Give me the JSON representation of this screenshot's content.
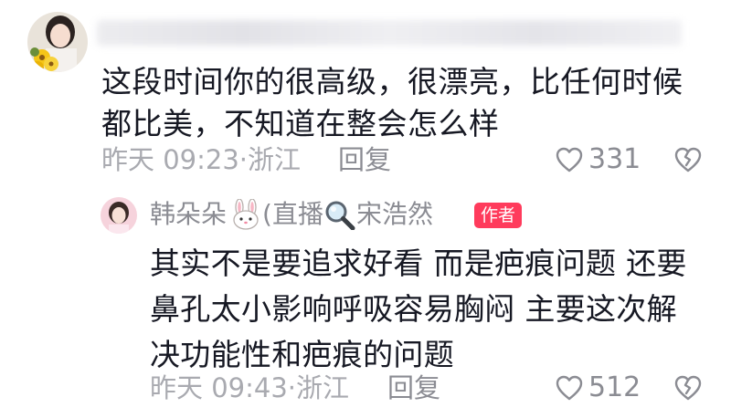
{
  "comment": {
    "text": "这段时间你的很高级，很漂亮，比任何时候都比美，不知道在整会怎么样",
    "time": "昨天 09:23",
    "location": "·浙江",
    "reply_label": "回复",
    "like_count": "331"
  },
  "reply": {
    "author_name": "韩朵朵",
    "name_suffix_a": "(直播",
    "name_suffix_b": "宋浩然",
    "author_badge": "作者",
    "text": "其实不是要追求好看 而是疤痕问题 还要鼻孔太小影响呼吸容易胸闷 主要这次解决功能性和疤痕的问题",
    "time": "昨天 09:43",
    "location": "·浙江",
    "reply_label": "回复",
    "like_count": "512"
  },
  "icons": {
    "like": "heart-outline-icon",
    "dislike": "broken-heart-icon",
    "rabbit": "rabbit-face-emoji",
    "search": "magnifier-emoji"
  },
  "colors": {
    "primary_text": "#161823",
    "secondary_text": "#8b8c93",
    "meta_text": "#a9aab0",
    "author_badge": "#ff3b5c"
  }
}
